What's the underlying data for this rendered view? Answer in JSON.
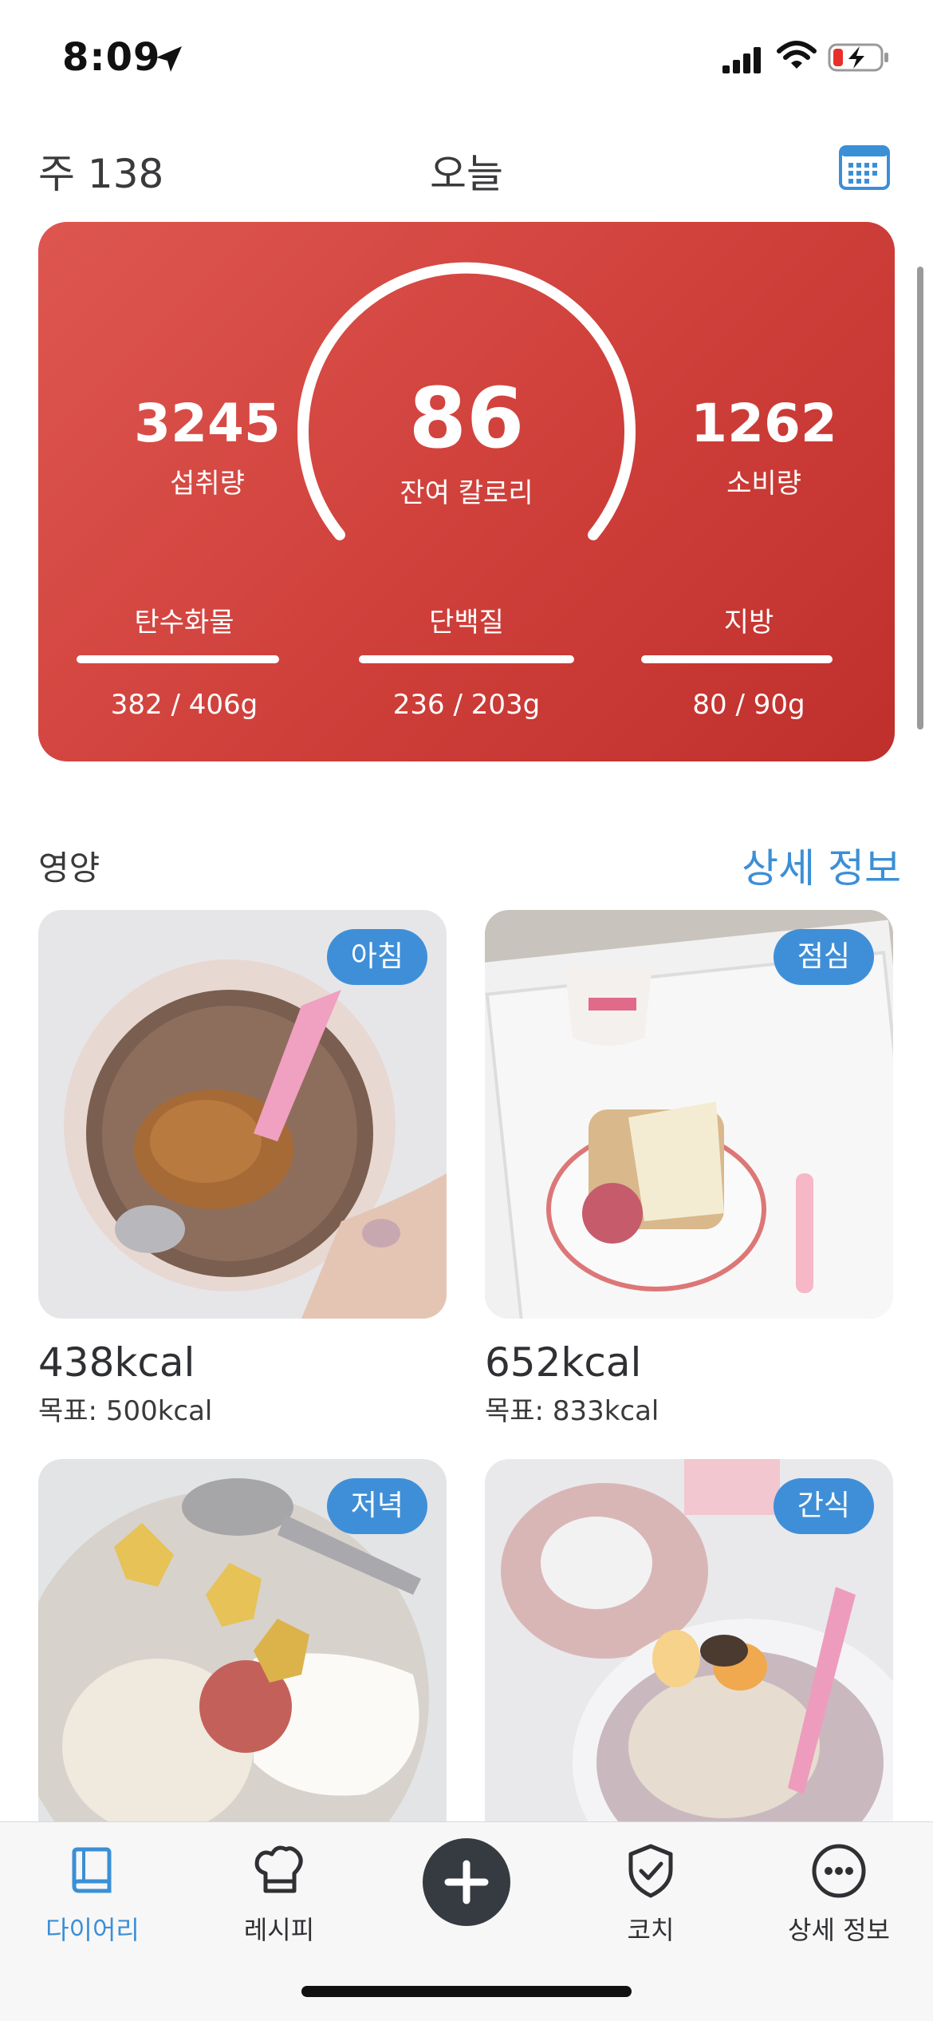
{
  "status_bar": {
    "time": "8:09"
  },
  "header": {
    "week": "주 138",
    "title": "오늘"
  },
  "summary": {
    "intake": {
      "value": "3245",
      "label": "섭취량"
    },
    "remaining": {
      "value": "86",
      "label": "잔여 칼로리"
    },
    "burned": {
      "value": "1262",
      "label": "소비량"
    },
    "macros": [
      {
        "label": "탄수화물",
        "value": "382 / 406g",
        "progress": 0.94
      },
      {
        "label": "단백질",
        "value": "236 / 203g",
        "progress": 1.0
      },
      {
        "label": "지방",
        "value": "80 / 90g",
        "progress": 0.89
      }
    ]
  },
  "nutrition": {
    "title": "영양",
    "details_link": "상세 정보"
  },
  "meals": [
    {
      "badge": "아침",
      "kcal": "438kcal",
      "goal": "목표: 500kcal"
    },
    {
      "badge": "점심",
      "kcal": "652kcal",
      "goal": "목표: 833kcal"
    },
    {
      "badge": "저녁"
    },
    {
      "badge": "간식"
    }
  ],
  "tabs": [
    {
      "label": "다이어리",
      "icon": "book-icon"
    },
    {
      "label": "레시피",
      "icon": "chef-hat-icon"
    },
    {
      "label": "",
      "icon": "plus-icon"
    },
    {
      "label": "코치",
      "icon": "shield-check-icon"
    },
    {
      "label": "상세 정보",
      "icon": "more-icon"
    }
  ],
  "colors": {
    "card": "#d2433e",
    "accent": "#3b8fd6",
    "badge": "#3f8fd8"
  }
}
